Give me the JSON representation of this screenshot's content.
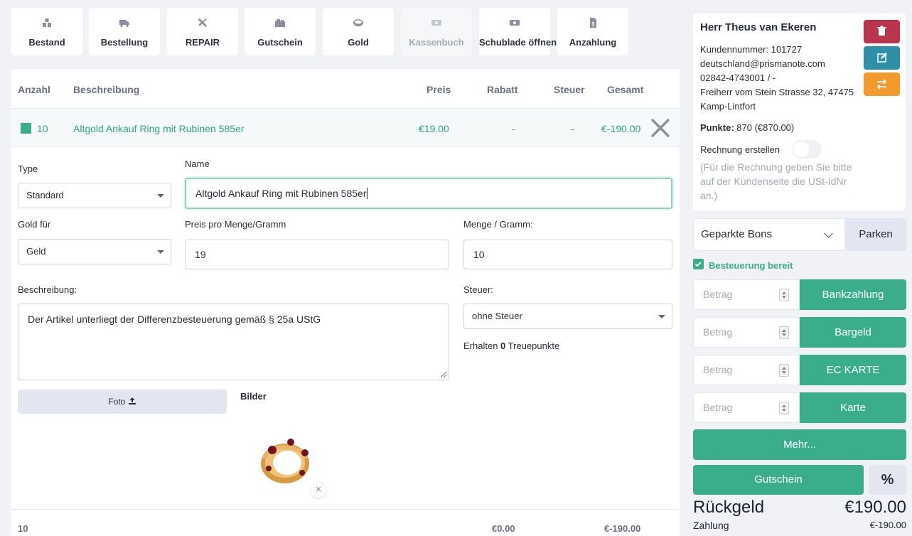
{
  "toolbar": {
    "tiles": [
      {
        "label": "Bestand",
        "icon": "boxes-icon",
        "disabled": false
      },
      {
        "label": "Bestellung",
        "icon": "truck-icon",
        "disabled": false
      },
      {
        "label": "REPAIR",
        "icon": "tools-icon",
        "disabled": false
      },
      {
        "label": "Gutschein",
        "icon": "voucher-icon",
        "disabled": false
      },
      {
        "label": "Gold",
        "icon": "gold-coin-icon",
        "disabled": false
      },
      {
        "label": "Kassenbuch",
        "icon": "cash-book-icon",
        "disabled": true
      },
      {
        "label": "Schublade öffnen",
        "icon": "cash-drawer-icon",
        "disabled": false
      },
      {
        "label": "Anzahlung",
        "icon": "deposit-icon",
        "disabled": false
      }
    ]
  },
  "table": {
    "headers": {
      "anzahl": "Anzahl",
      "beschreibung": "Beschreibung",
      "preis": "Preis",
      "rabatt": "Rabatt",
      "steuer": "Steuer",
      "gesamt": "Gesamt"
    },
    "row": {
      "anzahl": "10",
      "beschreibung": "Altgold Ankauf Ring mit Rubinen 585er",
      "preis": "€19.00",
      "rabatt": "-",
      "steuer": "-",
      "gesamt": "€-190.00"
    }
  },
  "form": {
    "type_label": "Type",
    "type_value": "Standard",
    "name_label": "Name",
    "name_value": "Altgold Ankauf Ring mit Rubinen 585er",
    "gold_fuer_label": "Gold für",
    "gold_fuer_value": "Geld",
    "preis_label": "Preis pro Menge/Gramm",
    "preis_value": "19",
    "menge_label": "Menge / Gramm:",
    "menge_value": "10",
    "beschreibung_label": "Beschreibung:",
    "beschreibung_value": "Der Artikel unterliegt der Differenzbesteuerung gemäß § 25a UStG",
    "steuer_label": "Steuer:",
    "steuer_value": "ohne Steuer",
    "treue_prefix": "Erhalten ",
    "treue_count": "0",
    "treue_suffix": " Treuepunkte",
    "foto_label": "Foto",
    "bilder_label": "Bilder"
  },
  "footer": {
    "count": "10",
    "rabatt": "€0.00",
    "gesamt": "€-190.00"
  },
  "customer": {
    "name": "Herr Theus van Ekeren",
    "kundennummer": "Kundennummer: 101727",
    "email": "deutschland@prismanote.com",
    "phone": "02842-4743001 / -",
    "address1": "Freiherr vom Stein Strasse 32, 47475",
    "address2": "Kamp-Lintfort",
    "punkte_label": "Punkte:",
    "punkte_value": " 870 (€870.00)",
    "rechnung_label": "Rechnung erstellen",
    "rechnung_hint": "(Für die Rechnung geben Sie bitte auf der Kundenseite die USt-IdNr an.)",
    "delete_color": "#b8354d",
    "edit_color": "#2e8fa6",
    "swap_color": "#f29a2e"
  },
  "checkout": {
    "bons_label": "Geparkte Bons",
    "parken_label": "Parken",
    "besteuerung_label": "Besteuerung bereit",
    "amount_placeholder": "Betrag",
    "payments": [
      "Bankzahlung",
      "Bargeld",
      "EC KARTE",
      "Karte"
    ],
    "mehr_label": "Mehr...",
    "gutschein_label": "Gutschein",
    "percent_label": "%",
    "rueckgeld_label": "Rückgeld",
    "rueckgeld_value": "€190.00",
    "zahlung_label": "Zahlung",
    "zahlung_value": "€-190.00",
    "accent": "#3aae8b"
  }
}
